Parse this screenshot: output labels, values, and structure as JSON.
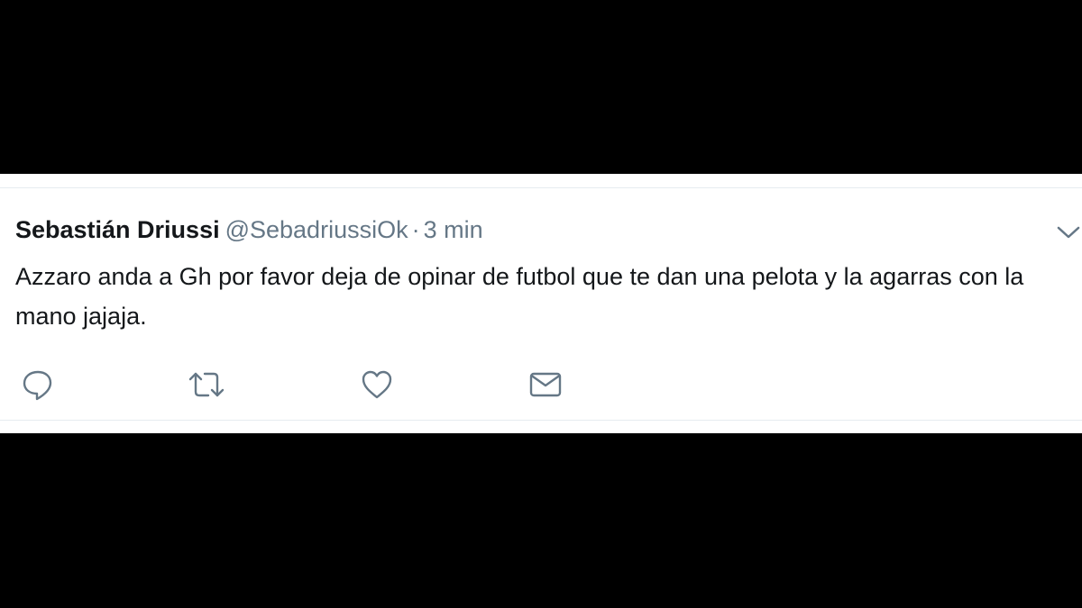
{
  "tweet": {
    "author_name": "Sebastián Driussi",
    "handle": "@SebadriussiOk",
    "separator": "·",
    "time": "3 min",
    "text": "Azzaro anda a Gh por favor deja de opinar de futbol que te dan una pelota y la agarras con la mano jajaja."
  },
  "actions": {
    "icons": [
      "reply-icon",
      "retweet-icon",
      "like-icon",
      "direct-message-icon",
      "chevron-down-icon"
    ]
  },
  "colors": {
    "background_band": "#000000",
    "card": "#ffffff",
    "text_primary": "#14171a",
    "text_secondary": "#657786",
    "divider": "#e6ecf0"
  }
}
